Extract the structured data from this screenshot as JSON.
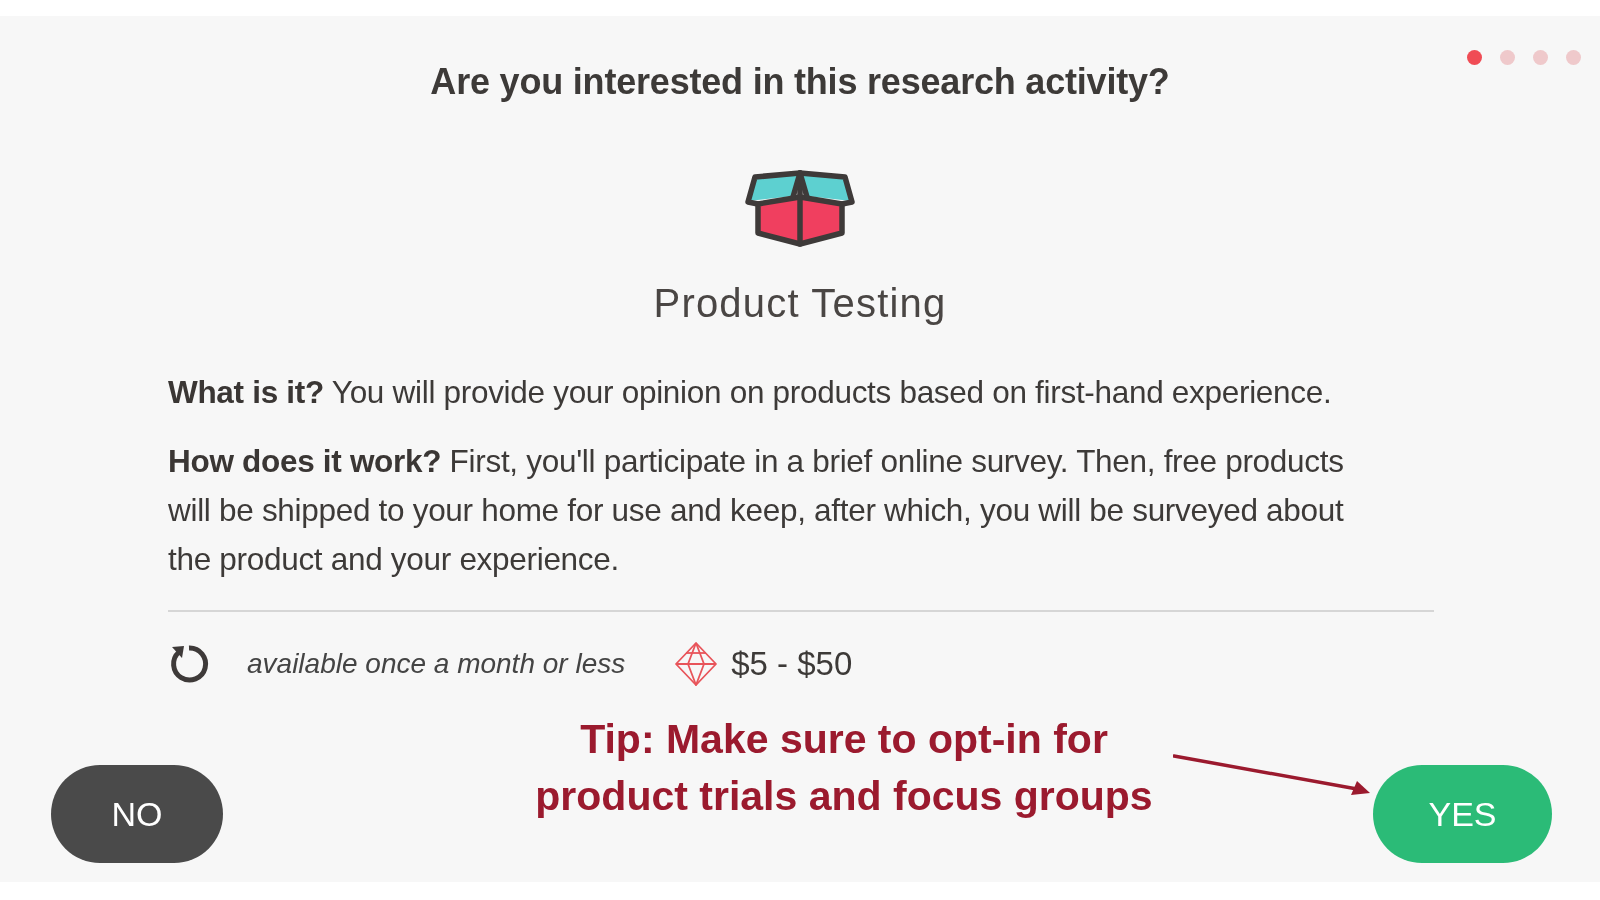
{
  "progress_dots": [
    {
      "selected": true
    },
    {
      "selected": false
    },
    {
      "selected": false
    },
    {
      "selected": false
    }
  ],
  "title": "Are you interested in this research activity?",
  "activity": {
    "name": "Product Testing"
  },
  "description": [
    "**What is it?** You will provide your opinion on products based on first-hand experience.",
    "**How does it work?** First, you'll participate in a brief online survey. Then, free products will be shipped to your home for use and keep, after which, you will be surveyed about the product and your experience."
  ],
  "details": {
    "frequency": "available once a month or less",
    "reward": "$5 - $50"
  },
  "tip": "Tip: Make sure to opt-in for product trials and focus groups",
  "buttons": [
    {
      "label": "NO",
      "kind": "decline"
    },
    {
      "label": "YES",
      "kind": "accept"
    }
  ]
}
